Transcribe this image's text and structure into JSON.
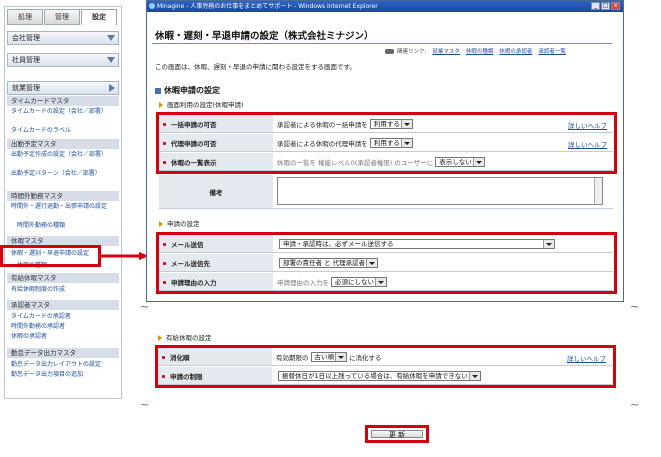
{
  "nav": {
    "tabs": [
      "処理",
      "管理",
      "設定"
    ],
    "menus": [
      {
        "label": "会社管理"
      },
      {
        "label": "社員管理"
      },
      {
        "label": "就業管理"
      }
    ],
    "sections": [
      {
        "title": "タイムカードマスタ",
        "items": [
          "タイムカードの設定（会社／部署）",
          "タイムカードのラベル"
        ]
      },
      {
        "title": "出勤予定マスタ",
        "items": [
          "出勤予定作成の設定（会社／部署）",
          "出勤予定パターン（会社／部署）"
        ]
      },
      {
        "title": "時間外勤務マスタ",
        "items": [
          "時間外・遅行退勤・出張申請の設定",
          "時間外勤務の種類"
        ]
      },
      {
        "title": "休暇マスタ",
        "items": [
          "休暇・遅刻・早退申請の設定",
          "休暇の種類"
        ]
      },
      {
        "title": "有給休暇マスタ",
        "items": [
          "有給休暇制度の作成"
        ]
      },
      {
        "title": "承認者マスタ",
        "items": [
          "タイムカードの承認者",
          "時間外勤務の承認者",
          "休暇の承認者"
        ]
      },
      {
        "title": "勤怠データ出力マスタ",
        "items": [
          "勤怠データ出力レイアウトの設定",
          "勤怠データ出力項目の追加"
        ]
      }
    ]
  },
  "window": {
    "title": "Minagine - 人事労務のお仕事をまとめてサポート - Windows Internet Explorer",
    "buttons": [
      "_",
      "□",
      "×"
    ]
  },
  "page": {
    "title": "休暇・遅刻・早退申請の設定（株式会社ミナジン）",
    "related_label": "関連リンク:",
    "related_links": [
      "就業マスタ",
      "休暇の種類",
      "休暇の承認者",
      "承認者一覧"
    ],
    "intro": "この画面は、休暇、遅刻・早退の申請に関わる設定をする画面です。",
    "section_title": "休暇申請の設定",
    "subhead_usage": "画面利用の設定(休暇申請)",
    "subhead_request": "申請の設定",
    "subhead_paid": "有給休暇の設定",
    "help": "詳しいヘルプ",
    "rows": {
      "bulk": {
        "label": "一括申請の可否",
        "text": "承認者による休暇の一括申請を",
        "value": "利用する"
      },
      "proxy": {
        "label": "代理申請の可否",
        "text": "承認者による休暇の代理申請を",
        "value": "利用する"
      },
      "list": {
        "label": "休暇の一覧表示",
        "text": "休暇の一覧を 権能レベル0(承認者権限) のユーザーに",
        "value": "表示しない"
      },
      "note": {
        "label": "備考"
      },
      "mail": {
        "label": "メール送信",
        "value": "申請・承認時は、必ずメール送信する"
      },
      "mailto": {
        "label": "メール送信先",
        "value": "部署の責任者 と 代理承認者"
      },
      "reason": {
        "label": "申請理由の入力",
        "text": "申請理由の入力を",
        "value": "必須にしない"
      },
      "order": {
        "label": "消化順",
        "text1": "有効期限の",
        "value": "古い順",
        "text2": "に消化する"
      },
      "limit": {
        "label": "申請の制限",
        "value": "振替休日が1日以上残っている場合は、有給休暇を申請できない"
      }
    },
    "update_button": "更 新"
  },
  "colors": {
    "highlight": "#d6000f",
    "accent": "#1d4fa0"
  }
}
